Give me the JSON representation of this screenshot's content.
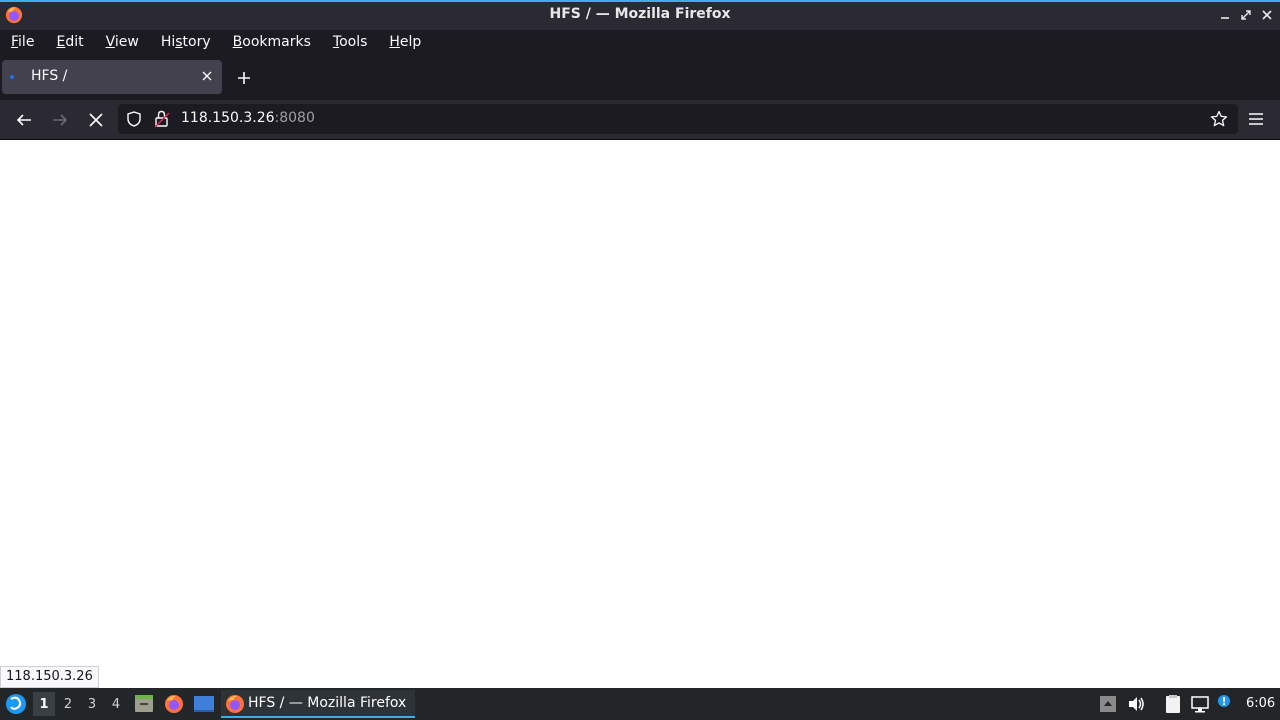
{
  "window": {
    "title": "HFS / — Mozilla Firefox"
  },
  "menubar": {
    "items": [
      {
        "label": "File",
        "mnemonic": "F",
        "rest": "ile"
      },
      {
        "label": "Edit",
        "mnemonic": "E",
        "rest": "dit"
      },
      {
        "label": "View",
        "mnemonic": "V",
        "rest": "iew"
      },
      {
        "label": "History",
        "pre": "Hi",
        "mnemonic": "s",
        "rest": "tory"
      },
      {
        "label": "Bookmarks",
        "mnemonic": "B",
        "rest": "ookmarks"
      },
      {
        "label": "Tools",
        "mnemonic": "T",
        "rest": "ools"
      },
      {
        "label": "Help",
        "mnemonic": "H",
        "rest": "elp"
      }
    ]
  },
  "tabs": [
    {
      "label": "HFS /",
      "loading": true
    }
  ],
  "navbar": {
    "url_host": "118.150.3.26",
    "url_port": ":8080"
  },
  "status": {
    "link": "118.150.3.26"
  },
  "taskbar": {
    "workspaces": [
      "1",
      "2",
      "3",
      "4"
    ],
    "active_workspace": "1",
    "task_label": "HFS / — Mozilla Firefox",
    "clock": "6:06"
  },
  "colors": {
    "accent": "#3daee9",
    "chrome_dark": "#1c1b22",
    "toolbar": "#2b2a33",
    "tab_selected": "#42414d"
  }
}
